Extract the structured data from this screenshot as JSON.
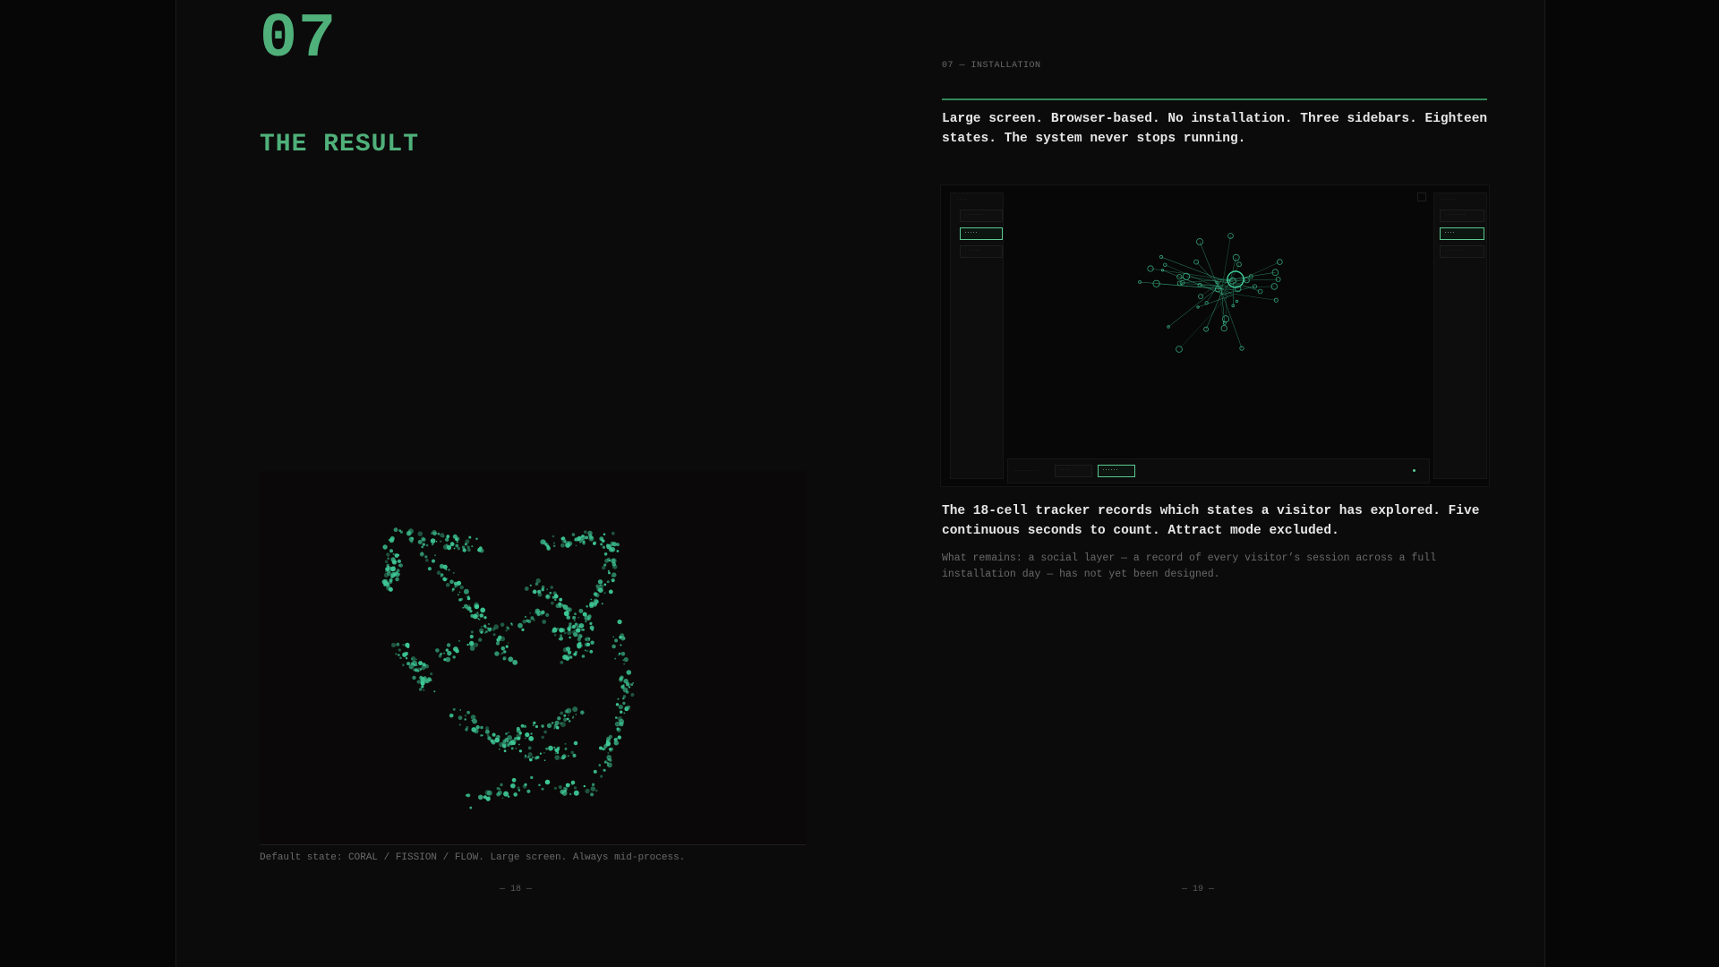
{
  "left_page": {
    "chapter_number": "07",
    "title": "THE RESULT",
    "caption": "Default state: CORAL / FISSION / FLOW. Large screen. Always mid-process.",
    "page_number": "— 18 —"
  },
  "right_page": {
    "running_header": "07 — INSTALLATION",
    "lead": "Large screen. Browser-based. No installation. Three sidebars. Eighteen states. The system never stops running.",
    "body": "The 18-cell tracker records which states a visitor has explored. Five continuous seconds to count. Attract mode excluded.",
    "note": "What remains: a social layer — a record of every visitor’s session across a full installation day — has not yet been designed.",
    "page_number": "— 19 —"
  },
  "colors": {
    "accent": "#4fb07a",
    "particle": "#3ec896",
    "page_bg": "#0b0b0b",
    "outer_bg": "#060606"
  }
}
